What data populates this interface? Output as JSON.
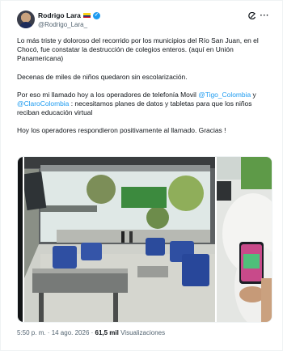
{
  "author": {
    "name": "Rodrigo Lara",
    "handle": "@Rodrigo_Lara_"
  },
  "tweet": {
    "p1": "Lo más triste y doloroso del recorrido por los municipios del Río San Juan, en el Chocó, fue constatar la destrucción de colegios enteros. (aquí en Unión Panamericana)",
    "p2": "Decenas de miles de niños quedaron sin escolarización.",
    "p3_pre": "Por eso mi llamado hoy a los operadores de telefonía Movil ",
    "mention1": "@Tigo_Colombia",
    "p3_mid": " y ",
    "mention2": "@ClaroColombia",
    "p3_post": " : necesitamos planes de datos y tabletas para que los niños reciban educación virtual",
    "p4": "Hoy los operadores respondieron positivamente al llamado. Gracias !"
  },
  "meta": {
    "time": "5:50 p. m.",
    "sep1": " · ",
    "date": "14 ago. 2026",
    "sep2": " · ",
    "views": "61,5 mil",
    "views_label": " Visualizaciones"
  },
  "icons": {
    "verified": "verified-badge-icon",
    "flag": "colombia-flag-icon",
    "grok": "grok-icon",
    "more": "more-options-icon"
  },
  "colors": {
    "link": "#1d9bf0",
    "secondary": "#536471",
    "verified": "#1d9bf0"
  }
}
